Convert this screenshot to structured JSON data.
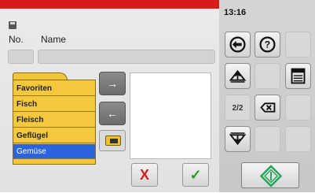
{
  "status": {
    "time": "13:16"
  },
  "form": {
    "no_label": "No.",
    "name_label": "Name",
    "no_value": "",
    "name_value": ""
  },
  "folders": [
    {
      "label": "Favoriten",
      "selected": false
    },
    {
      "label": "Fisch",
      "selected": false
    },
    {
      "label": "Fleisch",
      "selected": false
    },
    {
      "label": "Geflügel",
      "selected": false
    },
    {
      "label": "Gemüse",
      "selected": true
    }
  ],
  "buttons": {
    "move_right": "→",
    "move_left": "←",
    "cancel": "X",
    "ok": "✓"
  },
  "pager": {
    "page": "2/2"
  },
  "colors": {
    "title_bar": "#d71b1b",
    "folder": "#f3c83c",
    "selected": "#2c63df",
    "start": "#25a65b"
  },
  "icons": [
    "save-icon",
    "folder-icon",
    "back-icon",
    "help-icon",
    "page-up-icon",
    "page-down-icon",
    "program-list-icon",
    "backspace-icon",
    "start-icon"
  ]
}
